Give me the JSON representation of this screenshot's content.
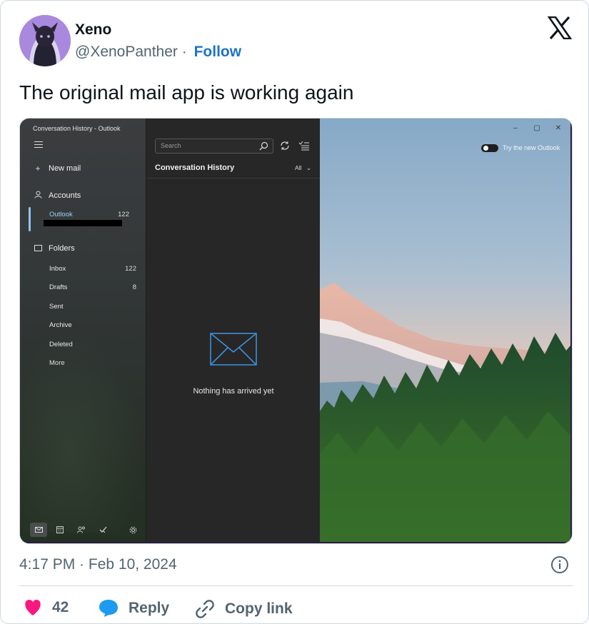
{
  "tweet": {
    "name": "Xeno",
    "handle": "@XenoPanther",
    "separator": "·",
    "follow_label": "Follow",
    "text": "The original mail app is working again",
    "timestamp": "4:17 PM · Feb 10, 2024",
    "like_count": "42",
    "reply_label": "Reply",
    "copy_label": "Copy link",
    "like_color": "#f91880",
    "reply_icon_color": "#1d9bf0",
    "follow_color": "#1d74c5"
  },
  "mail_app": {
    "window_title": "Conversation History - Outlook",
    "nav": {
      "new_mail": "New mail",
      "accounts": "Accounts",
      "account_name": "Outlook",
      "account_count": "122",
      "folders": "Folders",
      "folder_items": [
        {
          "label": "Inbox",
          "count": "122"
        },
        {
          "label": "Drafts",
          "count": "8"
        },
        {
          "label": "Sent",
          "count": ""
        },
        {
          "label": "Archive",
          "count": ""
        },
        {
          "label": "Deleted",
          "count": ""
        },
        {
          "label": "More",
          "count": ""
        }
      ],
      "bottom_icons": [
        "mail-icon",
        "calendar-icon",
        "people-icon",
        "todo-icon",
        "settings-icon"
      ]
    },
    "list": {
      "search_placeholder": "Search",
      "folder_title": "Conversation History",
      "filter": "All",
      "empty_message": "Nothing has arrived yet"
    },
    "reading_pane": {
      "try_new": "Try the new Outlook",
      "window_buttons": [
        "–",
        "▢",
        "✕"
      ]
    }
  }
}
